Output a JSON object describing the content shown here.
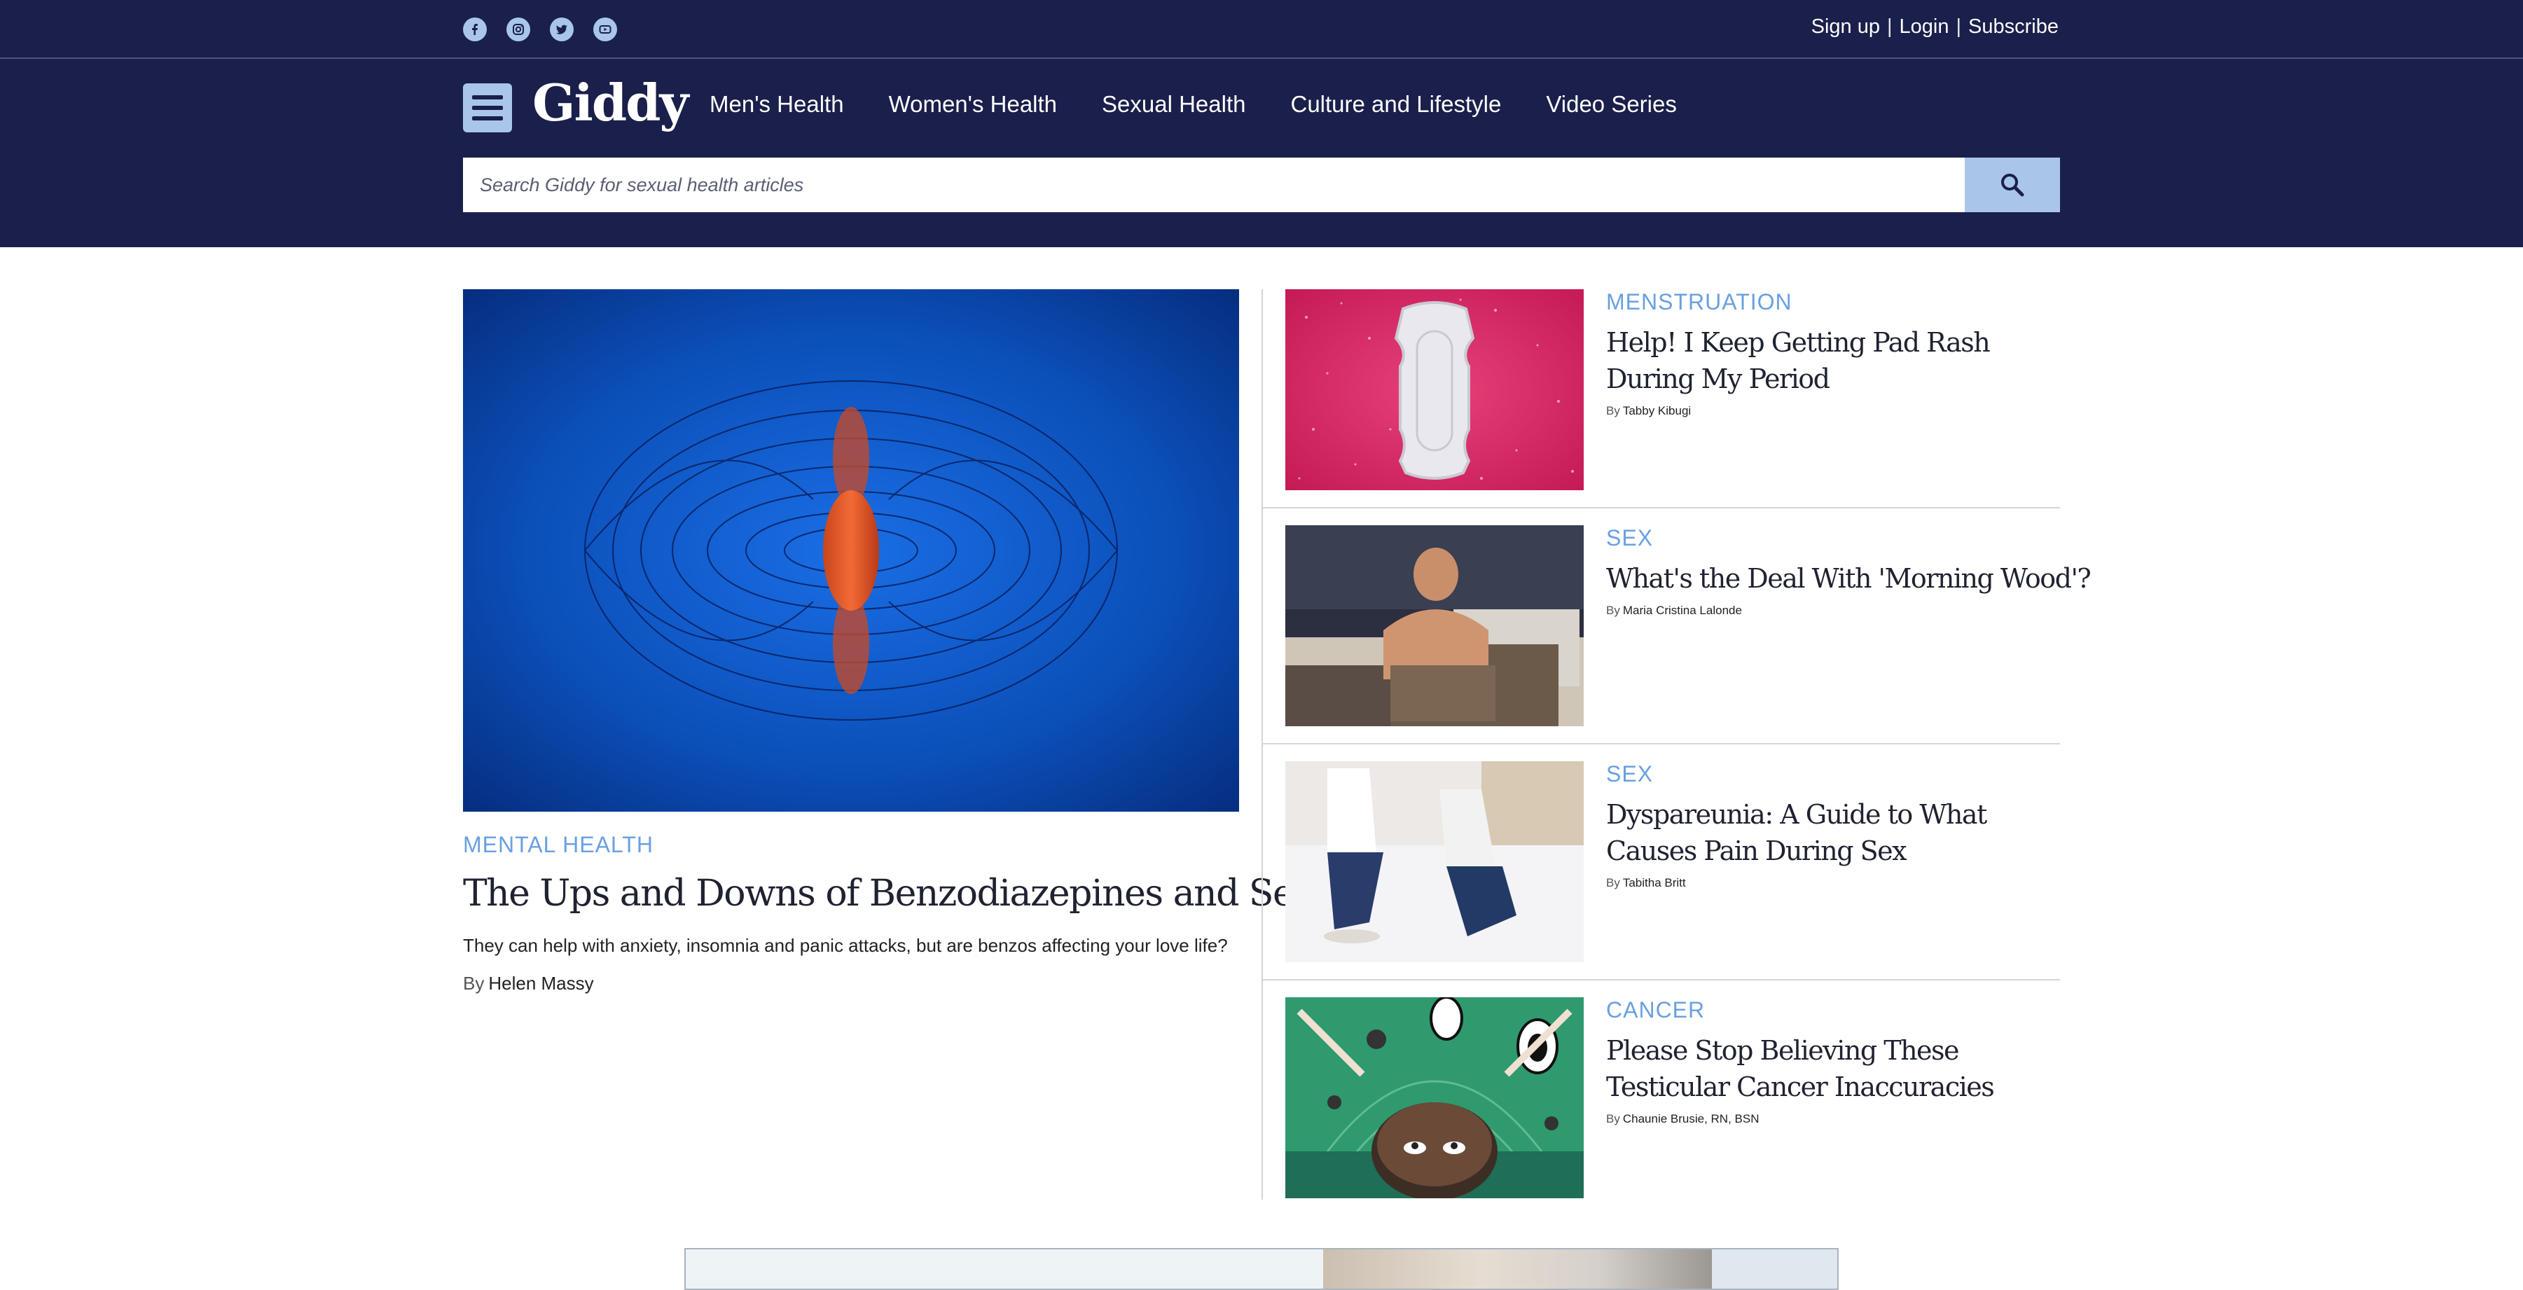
{
  "header": {
    "social": [
      "facebook-icon",
      "instagram-icon",
      "twitter-icon",
      "youtube-icon"
    ],
    "account": {
      "signup": "Sign up",
      "login": "Login",
      "subscribe": "Subscribe",
      "separator": "|"
    },
    "logo": "Giddy",
    "nav": [
      "Men's Health",
      "Women's Health",
      "Sexual Health",
      "Culture and Lifestyle",
      "Video Series"
    ],
    "search": {
      "placeholder": "Search Giddy for sexual health articles"
    }
  },
  "featured": {
    "category": "MENTAL HEALTH",
    "title": "The Ups and Downs of Benzodiazepines and Sex",
    "dek": "They can help with anxiety, insomnia and panic attacks, but are benzos affecting your love life?",
    "by": "By",
    "author": "Helen Massy"
  },
  "articles": [
    {
      "category": "MENSTRUATION",
      "title": "Help! I Keep Getting Pad Rash During My Period",
      "by": "By",
      "author": "Tabby Kibugi"
    },
    {
      "category": "SEX",
      "title": "What's the Deal With 'Morning Wood'?",
      "by": "By",
      "author": "Maria Cristina Lalonde"
    },
    {
      "category": "SEX",
      "title": "Dyspareunia: A Guide to What Causes Pain During Sex",
      "by": "By",
      "author": "Tabitha Britt"
    },
    {
      "category": "CANCER",
      "title": "Please Stop Believing These Testicular Cancer Inaccuracies",
      "by": "By",
      "author": "Chaunie Brusie, RN, BSN"
    }
  ],
  "colors": {
    "navy": "#1a1f4b",
    "accent": "#a9c6ea",
    "category": "#6aa0e0"
  }
}
